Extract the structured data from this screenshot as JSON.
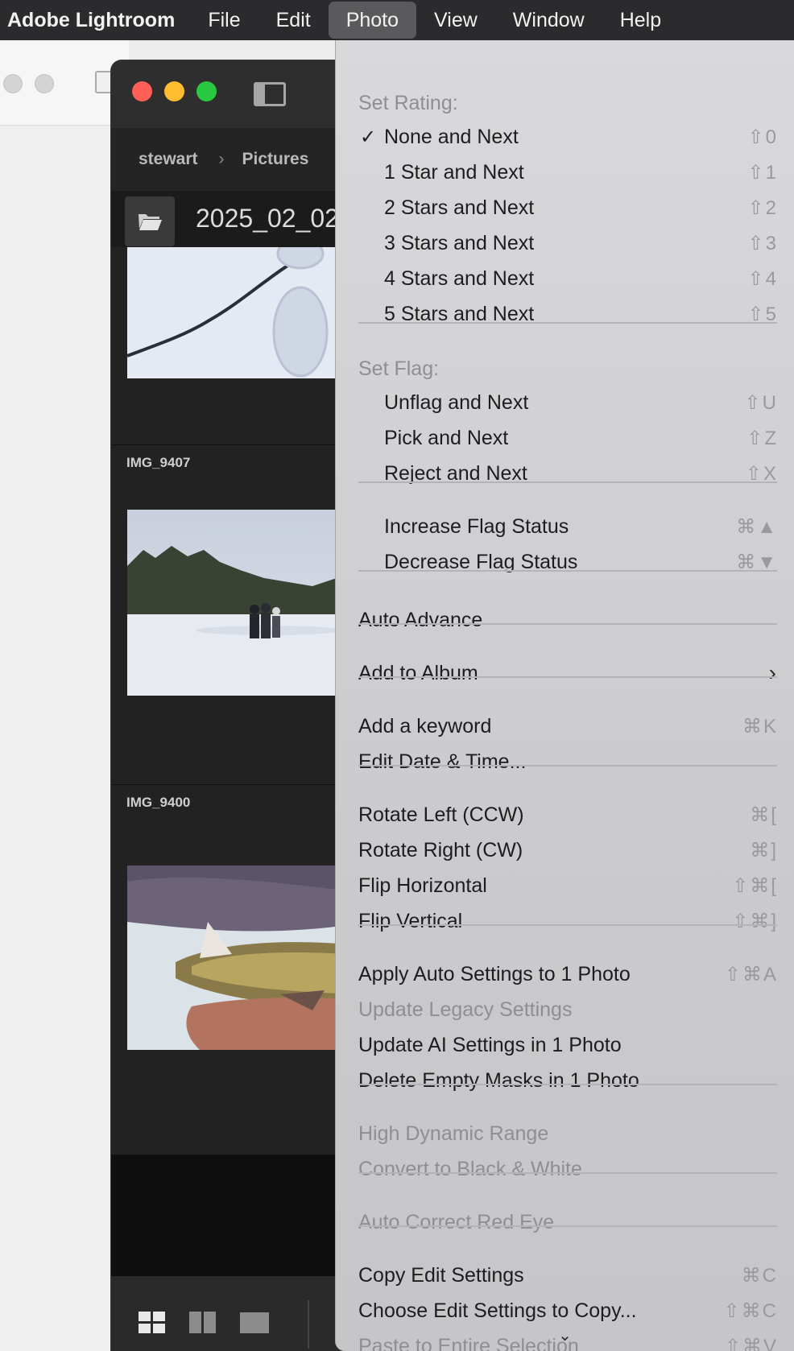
{
  "menubar": {
    "app_name": "Adobe Lightroom",
    "menus": [
      "File",
      "Edit",
      "Photo",
      "View",
      "Window",
      "Help"
    ],
    "open_menu": "Photo"
  },
  "lightroom": {
    "breadcrumb": [
      "stewart",
      "Pictures"
    ],
    "folder_title": "2025_02_02",
    "photos": [
      {
        "label": "",
        "subject": "footprints in snow"
      },
      {
        "label": "IMG_9407",
        "subject": "people walking on frozen lake"
      },
      {
        "label": "IMG_9400",
        "subject": "fish on ice"
      }
    ]
  },
  "photo_menu": {
    "set_rating_header": "Set Rating:",
    "rating_items": [
      {
        "label": "None and Next",
        "shortcut": "⇧0",
        "checked": true
      },
      {
        "label": "1 Star and Next",
        "shortcut": "⇧1",
        "checked": false
      },
      {
        "label": "2 Stars and Next",
        "shortcut": "⇧2",
        "checked": false
      },
      {
        "label": "3 Stars and Next",
        "shortcut": "⇧3",
        "checked": false
      },
      {
        "label": "4 Stars and Next",
        "shortcut": "⇧4",
        "checked": false
      },
      {
        "label": "5 Stars and Next",
        "shortcut": "⇧5",
        "checked": false
      }
    ],
    "set_flag_header": "Set Flag:",
    "flag_items": [
      {
        "label": "Unflag and Next",
        "shortcut": "⇧U"
      },
      {
        "label": "Pick and Next",
        "shortcut": "⇧Z"
      },
      {
        "label": "Reject and Next",
        "shortcut": "⇧X"
      }
    ],
    "flag_status_items": [
      {
        "label": "Increase Flag Status",
        "shortcut": "⌘▲"
      },
      {
        "label": "Decrease Flag Status",
        "shortcut": "⌘▼"
      }
    ],
    "auto_advance": {
      "label": "Auto Advance"
    },
    "add_to_album": {
      "label": "Add to Album",
      "submenu_indicator": "›"
    },
    "keyword_items": [
      {
        "label": "Add a keyword",
        "shortcut": "⌘K"
      },
      {
        "label": "Edit Date & Time...",
        "shortcut": ""
      }
    ],
    "transform_items": [
      {
        "label": "Rotate Left (CCW)",
        "shortcut": "⌘["
      },
      {
        "label": "Rotate Right (CW)",
        "shortcut": "⌘]"
      },
      {
        "label": "Flip Horizontal",
        "shortcut": "⇧⌘["
      },
      {
        "label": "Flip Vertical",
        "shortcut": "⇧⌘]"
      }
    ],
    "settings_items": [
      {
        "label": "Apply Auto Settings to 1 Photo",
        "shortcut": "⇧⌘A",
        "disabled": false
      },
      {
        "label": "Update Legacy Settings",
        "shortcut": "",
        "disabled": true
      },
      {
        "label": "Update AI Settings in 1 Photo",
        "shortcut": "",
        "disabled": false
      },
      {
        "label": "Delete Empty Masks in 1 Photo",
        "shortcut": "",
        "disabled": false
      }
    ],
    "hdr_items": [
      {
        "label": "High Dynamic Range",
        "disabled": true
      },
      {
        "label": "Convert to Black & White",
        "disabled": true
      }
    ],
    "red_eye": {
      "label": "Auto Correct Red Eye",
      "disabled": true
    },
    "copy_items": [
      {
        "label": "Copy Edit Settings",
        "shortcut": "⌘C",
        "disabled": false
      },
      {
        "label": "Choose Edit Settings to Copy...",
        "shortcut": "⇧⌘C",
        "disabled": false
      },
      {
        "label": "Paste to Entire Selection",
        "shortcut": "⇧⌘V",
        "disabled": true
      }
    ],
    "more_indicator": "⌄"
  }
}
